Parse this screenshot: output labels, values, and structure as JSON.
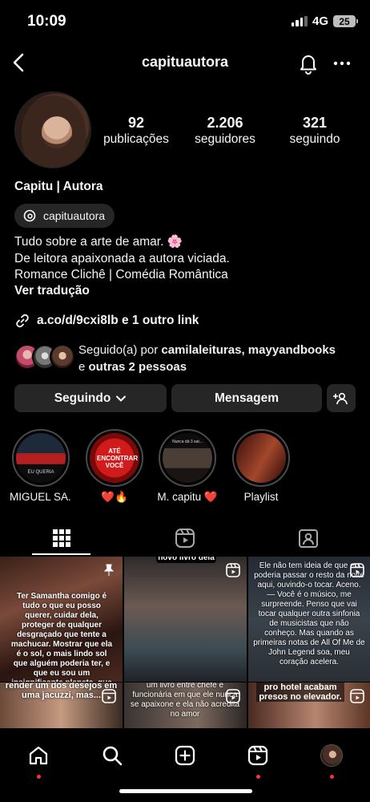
{
  "status": {
    "time": "10:09",
    "network": "4G",
    "battery": "25"
  },
  "header": {
    "username": "capituautora"
  },
  "profile": {
    "stats": [
      {
        "value": "92",
        "label": "publicações"
      },
      {
        "value": "2.206",
        "label": "seguidores"
      },
      {
        "value": "321",
        "label": "seguindo"
      }
    ],
    "display_name": "Capitu | Autora",
    "threads_handle": "capituautora",
    "bio": [
      "Tudo sobre a arte de amar. 🌸",
      "De leitora apaixonada a autora viciada.",
      "Romance Clichê | Comédia Romântica"
    ],
    "translate": "Ver tradução",
    "link": "a.co/d/9cxi8lb e 1 outro link",
    "followed_by": {
      "prefix": "Seguido(a) por ",
      "names": "camilaleituras, mayyandbooks",
      "middle": "e ",
      "others": "outras 2 pessoas"
    }
  },
  "buttons": {
    "following": "Seguindo",
    "message": "Mensagem"
  },
  "highlights": [
    {
      "label": "MIGUEL SA...",
      "cover_text": "EU QUERIA"
    },
    {
      "label": "❤️🔥",
      "cover_text": "ATÉ ENCONTRAR VOCÊ"
    },
    {
      "label": "M. capitu ❤️",
      "cover_text": "Nunca dá 3 sat..."
    },
    {
      "label": "Playlist",
      "cover_text": ""
    }
  ],
  "tabs": [
    "grid",
    "reels",
    "tagged"
  ],
  "grid": [
    {
      "caption": "Ter Samantha comigo é tudo o que eu posso querer, cuidar dela, proteger de qualquer desgraçado que tente a machucar. Mostrar que ela é o sol, o mais lindo sol que alguém poderia ter, e que eu sou um insignificante planeta, que só se mantém em pé, e nos eixos se for para girar em sua órbita.",
      "top_caption": "",
      "bottom_caption": "render um dos desejos em uma jacuzzi, mas..."
    },
    {
      "caption": "",
      "top_caption": "novo livro dela",
      "bottom_caption": "um livro entre chefe e funcionária em que ele nunca se apaixone e ela não acredita no amor"
    },
    {
      "caption": "Ele não tem ideia de que eu poderia passar o resto da noite aqui, ouvindo-o tocar. Aceno. — Você é o músico, me surpreende. Penso que vai tocar qualquer outra sinfonia de musicistas que não conheço. Mas quando as primeiras notas de All Of Me de John Legend soa, meu coração acelera.",
      "top_caption": "",
      "bottom_caption": "pro hotel acabam presos no elevador."
    }
  ],
  "colors": {
    "background": "#000000",
    "button": "#262626",
    "notification_dot": "#ff3040"
  }
}
